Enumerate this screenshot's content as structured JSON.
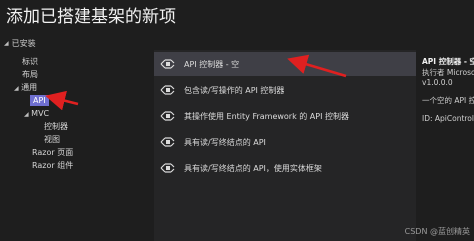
{
  "title": "添加已搭建基架的新项",
  "tree": {
    "root": "已安装",
    "items": [
      "标识",
      "布局",
      "通用",
      "API",
      "MVC",
      "控制器",
      "视图",
      "Razor 页面",
      "Razor 组件"
    ]
  },
  "templates": [
    "API 控制器 - 空",
    "包含读/写操作的 API 控制器",
    "其操作使用 Entity Framework 的 API 控制器",
    "具有读/写终结点的 API",
    "具有读/写终结点的 API，使用实体框架"
  ],
  "details": {
    "title": "API 控制器 - 空",
    "author": "执行者 Microsoft",
    "version": "v1.0.0.0",
    "description": "一个空的 API 控制器",
    "id": "ID: ApiController"
  },
  "watermark": "CSDN @蓝创精英"
}
